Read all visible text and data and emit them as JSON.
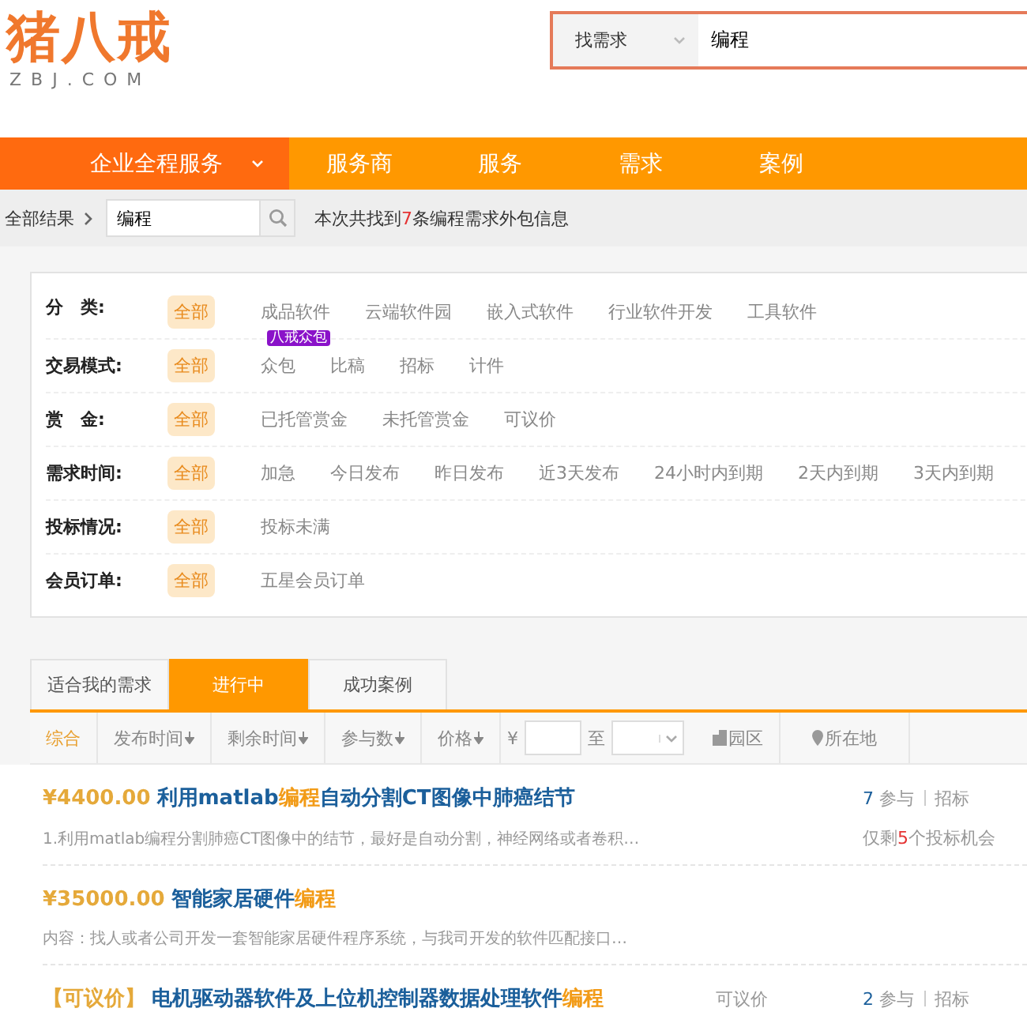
{
  "logo": {
    "name": "猪八戒",
    "domain": "ZBJ.COM"
  },
  "search": {
    "scope": "找需求",
    "value": "编程"
  },
  "nav": [
    {
      "label": "企业全程服务",
      "selected": true,
      "dropdown": true
    },
    {
      "label": "服务商",
      "selected": false,
      "dropdown": false
    },
    {
      "label": "服务",
      "selected": false,
      "dropdown": false
    },
    {
      "label": "需求",
      "selected": false,
      "dropdown": false
    },
    {
      "label": "案例",
      "selected": false,
      "dropdown": false
    }
  ],
  "breadcrumb": {
    "root": "全部结果",
    "query": "编程",
    "summary": [
      {
        "text": "本次共找到",
        "highlight": false
      },
      {
        "text": "7",
        "highlight": true
      },
      {
        "text": "条编程需求外包信息",
        "highlight": false
      }
    ]
  },
  "filters": [
    {
      "label": "分　类:",
      "options": [
        {
          "text": "全部",
          "selected": true
        },
        {
          "text": "成品软件",
          "selected": false
        },
        {
          "text": "云端软件园",
          "selected": false
        },
        {
          "text": "嵌入式软件",
          "selected": false
        },
        {
          "text": "行业软件开发",
          "selected": false
        },
        {
          "text": "工具软件",
          "selected": false
        }
      ]
    },
    {
      "label": "交易模式:",
      "options": [
        {
          "text": "全部",
          "selected": true
        },
        {
          "text": "众包",
          "selected": false,
          "tag": "八戒众包"
        },
        {
          "text": "比稿",
          "selected": false
        },
        {
          "text": "招标",
          "selected": false
        },
        {
          "text": "计件",
          "selected": false
        }
      ]
    },
    {
      "label": "赏　金:",
      "options": [
        {
          "text": "全部",
          "selected": true
        },
        {
          "text": "已托管赏金",
          "selected": false
        },
        {
          "text": "未托管赏金",
          "selected": false
        },
        {
          "text": "可议价",
          "selected": false
        }
      ]
    },
    {
      "label": "需求时间:",
      "options": [
        {
          "text": "全部",
          "selected": true
        },
        {
          "text": "加急",
          "selected": false
        },
        {
          "text": "今日发布",
          "selected": false
        },
        {
          "text": "昨日发布",
          "selected": false
        },
        {
          "text": "近3天发布",
          "selected": false
        },
        {
          "text": "24小时内到期",
          "selected": false
        },
        {
          "text": "2天内到期",
          "selected": false
        },
        {
          "text": "3天内到期",
          "selected": false
        }
      ]
    },
    {
      "label": "投标情况:",
      "options": [
        {
          "text": "全部",
          "selected": true
        },
        {
          "text": "投标未满",
          "selected": false
        }
      ]
    },
    {
      "label": "会员订单:",
      "options": [
        {
          "text": "全部",
          "selected": true
        },
        {
          "text": "五星会员订单",
          "selected": false
        }
      ]
    }
  ],
  "tabs": [
    {
      "label": "适合我的需求",
      "selected": false
    },
    {
      "label": "进行中",
      "selected": true
    },
    {
      "label": "成功案例",
      "selected": false
    }
  ],
  "sort": [
    {
      "kind": "plain",
      "label": "综合",
      "selected": true
    },
    {
      "kind": "sortable",
      "label": "发布时间",
      "selected": false
    },
    {
      "kind": "sortable",
      "label": "剩余时间",
      "selected": false
    },
    {
      "kind": "sortable",
      "label": "参与数",
      "selected": false
    },
    {
      "kind": "sortable",
      "label": "价格",
      "selected": false
    },
    {
      "kind": "range",
      "currency": "¥",
      "to": "至"
    },
    {
      "kind": "park",
      "label": "园区"
    },
    {
      "kind": "location",
      "label": "所在地"
    }
  ],
  "listings": [
    {
      "price": "¥4400.00",
      "title": [
        {
          "text": "利用matlab",
          "highlight": false
        },
        {
          "text": "编程",
          "highlight": true
        },
        {
          "text": "自动分割CT图像中肺癌结节",
          "highlight": false
        }
      ],
      "description": "1.利用matlab编程分割肺癌CT图像中的结节，最好是自动分割，神经网络或者卷积…",
      "participants": "7",
      "participants_label": "参与",
      "mode": "招标",
      "remaining": [
        {
          "text": "仅剩",
          "highlight": false
        },
        {
          "text": "5",
          "highlight": true
        },
        {
          "text": "个投标机会",
          "highlight": false
        }
      ]
    },
    {
      "price": "¥35000.00",
      "title": [
        {
          "text": "智能家居硬件",
          "highlight": false
        },
        {
          "text": "编程",
          "highlight": true
        }
      ],
      "description": "内容：找人或者公司开发一套智能家居硬件程序系统，与我司开发的软件匹配接口…"
    },
    {
      "price": "【可议价】",
      "title": [
        {
          "text": "电机驱动器软件及上位机控制器数据处理软件",
          "highlight": false
        },
        {
          "text": "编程",
          "highlight": true
        }
      ],
      "budget": "可议价",
      "participants": "2",
      "participants_label": "参与",
      "mode": "招标"
    }
  ]
}
